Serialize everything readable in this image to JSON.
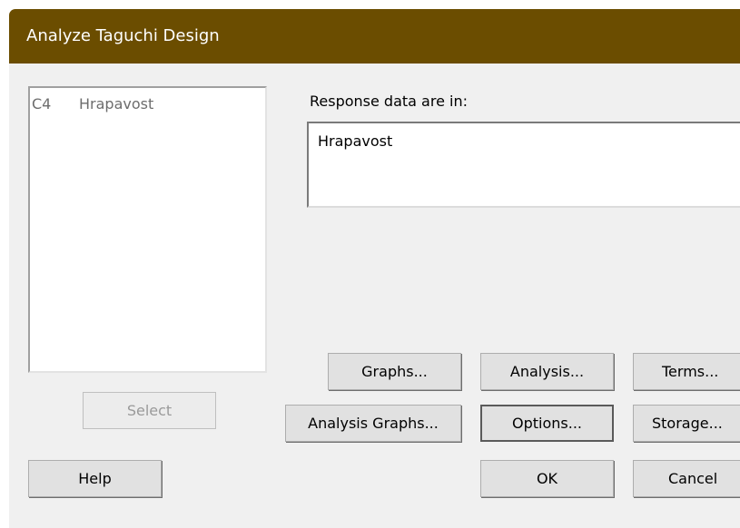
{
  "window": {
    "title": "Analyze Taguchi Design",
    "titlebar_color": "#6b4d00"
  },
  "variables": {
    "items": [
      {
        "column": "C4",
        "name": "Hrapavost"
      }
    ]
  },
  "response": {
    "label": "Response data are in:",
    "value": "Hrapavost"
  },
  "buttons": {
    "select": "Select",
    "help": "Help",
    "graphs": "Graphs...",
    "analysis": "Analysis...",
    "terms": "Terms...",
    "analysis_graphs": "Analysis Graphs...",
    "options": "Options...",
    "storage": "Storage...",
    "ok": "OK",
    "cancel": "Cancel"
  }
}
